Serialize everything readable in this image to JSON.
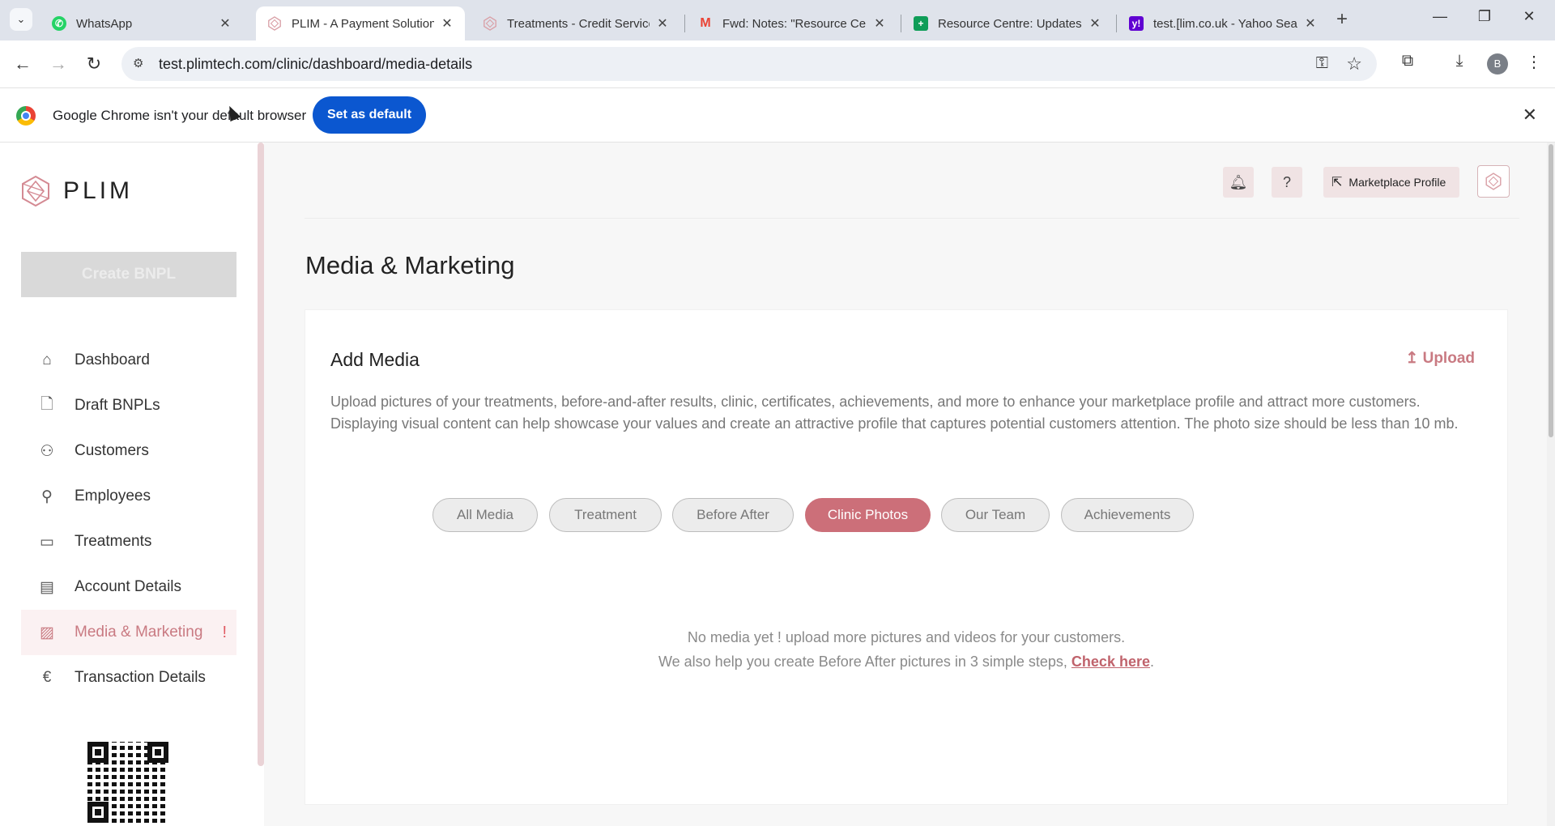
{
  "browser": {
    "tabs": [
      {
        "title": "WhatsApp",
        "favicon": "whatsapp-icon",
        "color": "#25d366"
      },
      {
        "title": "PLIM - A Payment Solution",
        "favicon": "plim-icon",
        "color": "#d9a0a7"
      },
      {
        "title": "Treatments - Credit Service",
        "favicon": "plim-icon",
        "color": "#d9a0a7"
      },
      {
        "title": "Fwd: Notes: \"Resource Cen",
        "favicon": "gmail-icon",
        "color": "#ea4335"
      },
      {
        "title": "Resource Centre: Updates",
        "favicon": "sheets-icon",
        "color": "#0f9d58"
      },
      {
        "title": "test.[lim.co.uk - Yahoo Sear",
        "favicon": "yahoo-icon",
        "color": "#6001d2"
      }
    ],
    "url": "test.plimtech.com/clinic/dashboard/media-details",
    "profile_initial": "B"
  },
  "infobar": {
    "message": "Google Chrome isn't your default browser",
    "button": "Set as default"
  },
  "sidebar": {
    "brand": "PLIM",
    "create_button": "Create BNPL",
    "items": [
      {
        "label": "Dashboard",
        "icon": "home-icon"
      },
      {
        "label": "Draft BNPLs",
        "icon": "document-icon"
      },
      {
        "label": "Customers",
        "icon": "users-icon"
      },
      {
        "label": "Employees",
        "icon": "user-plus-icon"
      },
      {
        "label": "Treatments",
        "icon": "treatments-icon"
      },
      {
        "label": "Account Details",
        "icon": "id-card-icon"
      },
      {
        "label": "Media & Marketing",
        "icon": "image-icon",
        "alert": "!"
      },
      {
        "label": "Transaction Details",
        "icon": "euro-icon"
      }
    ]
  },
  "header": {
    "marketplace_button": "Marketplace Profile"
  },
  "main": {
    "page_title": "Media & Marketing",
    "card_title": "Add Media",
    "upload_label": "Upload",
    "description": "Upload pictures of your treatments, before-and-after results, clinic, certificates, achievements, and more to enhance your marketplace profile and attract more customers. Displaying visual content can help showcase your values and create an attractive profile that captures potential customers attention. The photo size should be less than 10 mb.",
    "filters": [
      {
        "label": "All Media"
      },
      {
        "label": "Treatment"
      },
      {
        "label": "Before After"
      },
      {
        "label": "Clinic Photos",
        "selected": true
      },
      {
        "label": "Our Team"
      },
      {
        "label": "Achievements"
      }
    ],
    "empty_line1": "No media yet ! upload more pictures and videos for your customers.",
    "empty_line2": "We also help you create Before After pictures in 3 simple steps, ",
    "empty_link": "Check here",
    "empty_end": "."
  },
  "colors": {
    "accent": "#cc6f79",
    "sidebar_active_bg": "#fbf1f2",
    "chrome_blue": "#0b57d0"
  }
}
